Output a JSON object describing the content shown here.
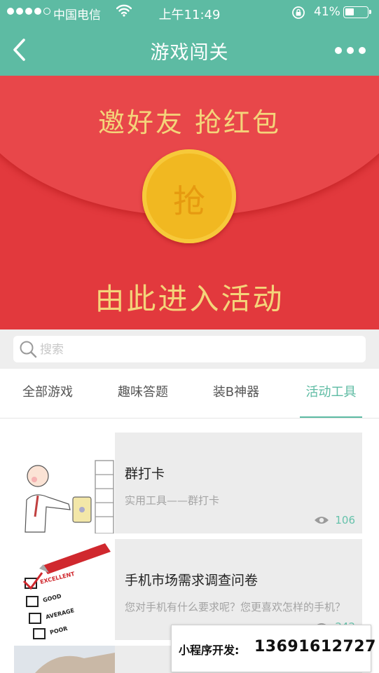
{
  "status_bar": {
    "carrier": "中国电信",
    "time": "上午11:49",
    "battery_percent": "41%",
    "battery_level": 0.41,
    "signal_bars_filled": 4,
    "signal_bars_total": 5
  },
  "nav": {
    "title": "游戏闯关",
    "back_icon": "chevron-left-icon",
    "more_icon": "more-dots-icon"
  },
  "banner": {
    "line1": "邀好友    抢红包",
    "coin_text": "抢",
    "line2": "由此进入活动"
  },
  "search": {
    "placeholder": "搜索",
    "value": ""
  },
  "tabs": [
    {
      "label": "全部游戏",
      "active": false
    },
    {
      "label": "趣味答题",
      "active": false
    },
    {
      "label": "装B神器",
      "active": false
    },
    {
      "label": "活动工具",
      "active": true
    }
  ],
  "items": [
    {
      "title": "群打卡",
      "description": "实用工具——群打卡",
      "views": "106"
    },
    {
      "title": "手机市场需求调查问卷",
      "description": "您对手机有什么要求呢？您更喜欢怎样的手机？",
      "views": "242"
    }
  ],
  "checklist_words": [
    "EXCELLENT",
    "GOOD",
    "AVERAGE",
    "POOR"
  ],
  "promo": {
    "label": "小程序开发:",
    "phone": "13691612727"
  },
  "colors": {
    "theme_green": "#5dbba3",
    "banner_red": "#e2393d",
    "banner_gold": "#f4d47a",
    "coin_gold": "#f1b821"
  }
}
